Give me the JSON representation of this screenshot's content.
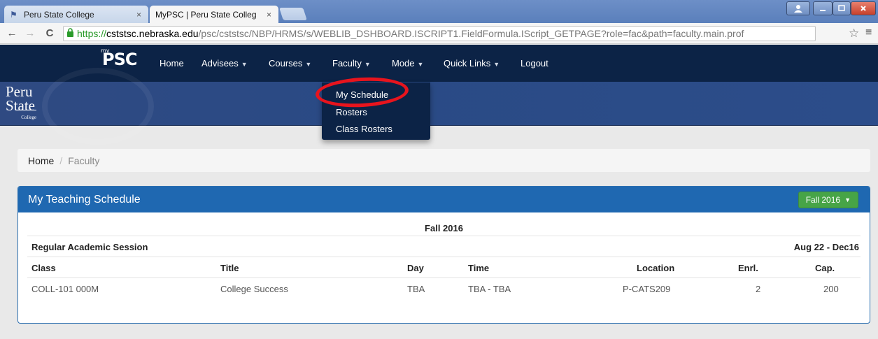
{
  "browser": {
    "tabs": [
      {
        "title": "Peru State College",
        "close": "×"
      },
      {
        "title": "MyPSC | Peru State Colleg",
        "close": "×"
      }
    ],
    "url": {
      "scheme": "https://",
      "host": "cststsc.nebraska.edu",
      "path": "/psc/cststsc/NBP/HRMS/s/WEBLIB_DSHBOARD.ISCRIPT1.FieldFormula.IScript_GETPAGE?role=fac&path=faculty.main.prof"
    },
    "icons": {
      "back": "back-arrow-icon",
      "forward": "forward-arrow-icon",
      "reload": "reload-icon",
      "lock": "lock-icon",
      "star": "bookmark-star-icon",
      "menu": "hamburger-menu-icon"
    }
  },
  "navbar": {
    "logo_small": "my",
    "logo": "PSC",
    "items": [
      {
        "label": "Home",
        "caret": ""
      },
      {
        "label": "Advisees",
        "caret": "▼"
      },
      {
        "label": "Courses",
        "caret": "▼"
      },
      {
        "label": "Faculty",
        "caret": "▼"
      },
      {
        "label": "Mode",
        "caret": "▼"
      },
      {
        "label": "Quick Links",
        "caret": "▼"
      },
      {
        "label": "Logout",
        "caret": ""
      }
    ]
  },
  "banner": {
    "line1": "Peru",
    "line2": "State",
    "line3": "College"
  },
  "faculty_menu": {
    "items": [
      "My Schedule",
      "Rosters",
      "Class Rosters"
    ]
  },
  "breadcrumb": {
    "home": "Home",
    "separator": "/",
    "current": "Faculty"
  },
  "panel": {
    "title": "My Teaching Schedule",
    "term_button": "Fall 2016",
    "term_heading": "Fall 2016",
    "session": "Regular Academic Session",
    "session_dates": "Aug 22 - Dec16",
    "columns": [
      "Class",
      "Title",
      "Day",
      "Time",
      "Location",
      "Enrl.",
      "Cap."
    ],
    "rows": [
      {
        "class": "COLL-101 000M",
        "title": "College Success",
        "day": "TBA",
        "time": "TBA - TBA",
        "location": "P-CATS209",
        "enrl": "2",
        "cap": "200"
      }
    ]
  },
  "colors": {
    "navbar": "#0c2346",
    "panel_header": "#1f68b1",
    "term_button": "#47a447",
    "callout": "#e8141d"
  }
}
